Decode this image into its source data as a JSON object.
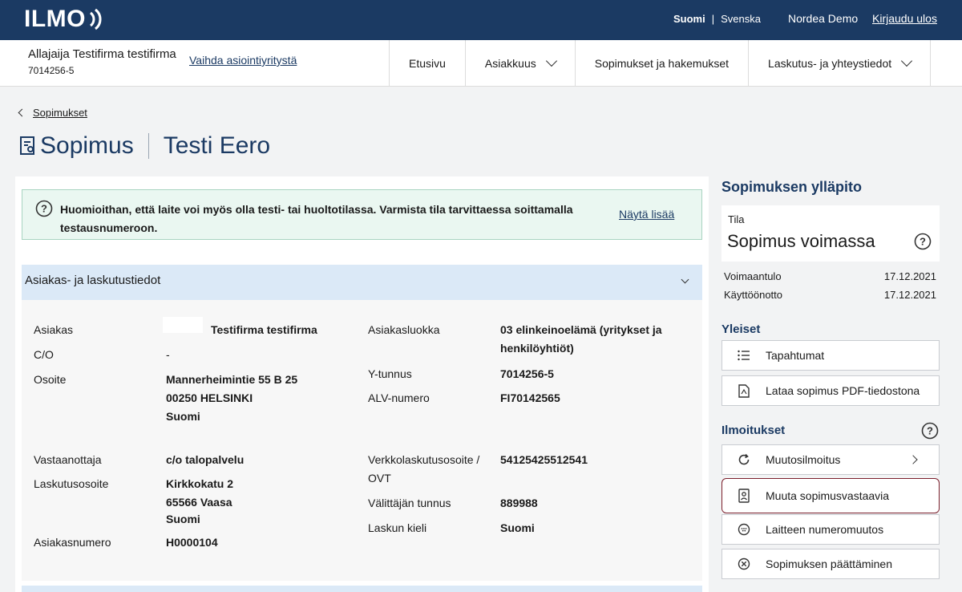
{
  "header": {
    "logo_text": "ILMO",
    "lang_active": "Suomi",
    "lang_separator": "|",
    "lang_other": "Svenska",
    "user": "Nordea Demo",
    "logout": "Kirjaudu ulos"
  },
  "company": {
    "name": "Allajaija Testifirma testifirma",
    "id": "7014256-5",
    "change_link": "Vaihda asiointiyritystä"
  },
  "nav": {
    "items": [
      {
        "label": "Etusivu",
        "dropdown": false
      },
      {
        "label": "Asiakkuus",
        "dropdown": true
      },
      {
        "label": "Sopimukset ja hakemukset",
        "dropdown": false
      },
      {
        "label": "Laskutus- ja yhteystiedot",
        "dropdown": true
      }
    ]
  },
  "breadcrumb": {
    "back_label": "Sopimukset"
  },
  "title": {
    "main": "Sopimus",
    "sub": "Testi Eero"
  },
  "notice": {
    "text": "Huomioithan, että laite voi myös olla testi- tai huoltotilassa. Varmista tila tarvittaessa soittamalla testausnumeroon.",
    "more_link": "Näytä lisää"
  },
  "section": {
    "title": "Asiakas- ja laskutustiedot",
    "left": [
      {
        "label": "Asiakas",
        "value": "Testifirma testifirma"
      },
      {
        "label": "C/O",
        "value": "-"
      },
      {
        "label": "Osoite",
        "value_lines": [
          "Mannerheimintie 55 B 25",
          "00250 HELSINKI",
          "Suomi"
        ]
      },
      {
        "label": "Vastaanottaja",
        "value": "c/o talopalvelu"
      },
      {
        "label": "Laskutusosoite",
        "value_lines": [
          "Kirkkokatu 2",
          "65566 Vaasa",
          "Suomi"
        ]
      },
      {
        "label": "Asiakasnumero",
        "value": "H0000104"
      }
    ],
    "right": [
      {
        "label": "Asiakasluokka",
        "value_lines": [
          "03 elinkeinoelämä (yritykset ja",
          "henkilöyhtiöt)"
        ]
      },
      {
        "label": "Y-tunnus",
        "value": "7014256-5"
      },
      {
        "label": "ALV-numero",
        "value": "FI70142565"
      },
      {
        "label_lines": [
          "Verkkolaskutusosoite /",
          "OVT"
        ],
        "value": "54125425512541"
      },
      {
        "label": "Välittäjän tunnus",
        "value": "889988"
      },
      {
        "label": "Laskun kieli",
        "value": "Suomi"
      }
    ]
  },
  "sidebar": {
    "title": "Sopimuksen ylläpito",
    "status_label": "Tila",
    "status_value": "Sopimus voimassa",
    "dates": [
      {
        "label": "Voimaantulo",
        "value": "17.12.2021"
      },
      {
        "label": "Käyttöönotto",
        "value": "17.12.2021"
      }
    ],
    "general_title": "Yleiset",
    "general_buttons": [
      "Tapahtumat",
      "Lataa sopimus PDF-tiedostona"
    ],
    "notices_title": "Ilmoitukset",
    "notice_buttons": [
      "Muutosilmoitus",
      "Muuta sopimusvastaavia",
      "Laitteen numeromuutos",
      "Sopimuksen päättäminen"
    ]
  },
  "colors": {
    "brand": "#1b3a63",
    "notice_bg": "#eaf7f1",
    "section_header": "#dbe9f7",
    "highlight": "#7b1f2c"
  }
}
